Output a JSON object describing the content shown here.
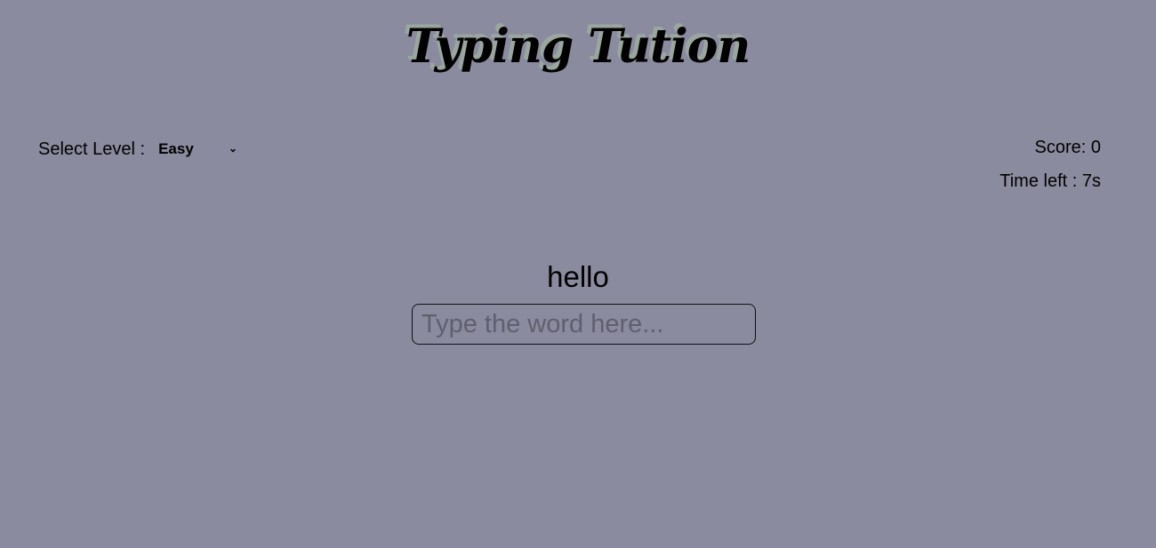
{
  "header": {
    "title": "Typing Tution"
  },
  "level": {
    "label": "Select Level :",
    "selected": "Easy"
  },
  "stats": {
    "score_text": "Score: 0",
    "time_text": "Time left : 7s"
  },
  "game": {
    "current_word": "hello",
    "input_value": "",
    "input_placeholder": "Type the word here..."
  },
  "colors": {
    "background": "#8b8ba0",
    "title_shadow": "#9aa79f"
  }
}
